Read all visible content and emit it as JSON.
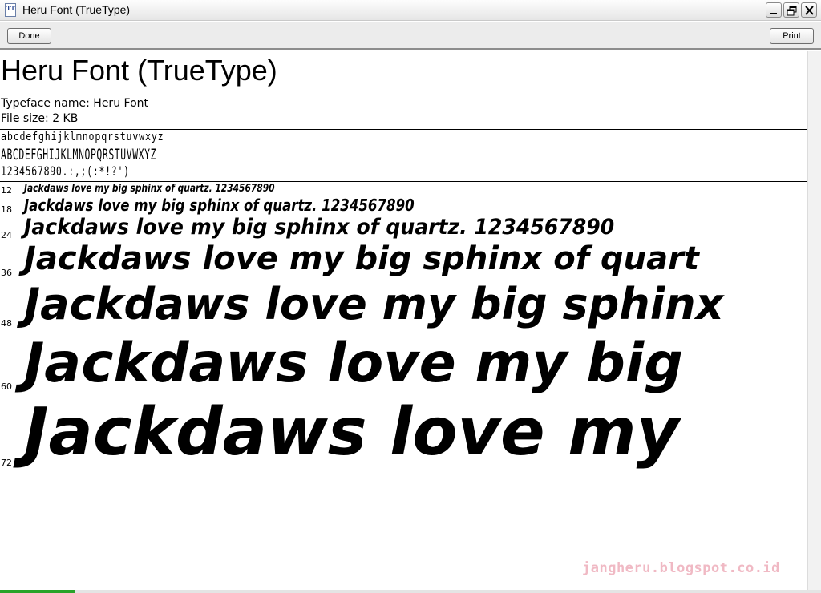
{
  "window": {
    "title": "Heru Font (TrueType)",
    "icon_label": "TT"
  },
  "toolbar": {
    "done_label": "Done",
    "print_label": "Print"
  },
  "content": {
    "heading": "Heru Font (TrueType)",
    "typeface": "Typeface name: Heru Font",
    "filesize": "File size: 2 KB",
    "lowercase": "abcdefghijklmnopqrstuvwxyz",
    "uppercase": "ABCDEFGHIJKLMNOPQRSTUVWXYZ",
    "digits": "1234567890.:,;(:*!?')",
    "samples": [
      {
        "size": "12",
        "text": "Jackdaws  love  my  big  sphinx  of  quartz.  1234567890"
      },
      {
        "size": "18",
        "text": "Jackdaws  love  my  big  sphinx  of  quartz.  1234567890"
      },
      {
        "size": "24",
        "text": "Jackdaws  love  my  big  sphinx  of  quartz.  1234567890"
      },
      {
        "size": "36",
        "text": "Jackdaws  love  my  big  sphinx  of  quart"
      },
      {
        "size": "48",
        "text": "Jackdaws  love  my  big  sphinx"
      },
      {
        "size": "60",
        "text": "Jackdaws  love  my  big"
      },
      {
        "size": "72",
        "text": "Jackdaws  love  my"
      }
    ]
  },
  "watermark": "jangheru.blogspot.co.id",
  "icons": [
    "minimize-icon",
    "maximize-icon",
    "close-icon",
    "font-file-icon"
  ]
}
